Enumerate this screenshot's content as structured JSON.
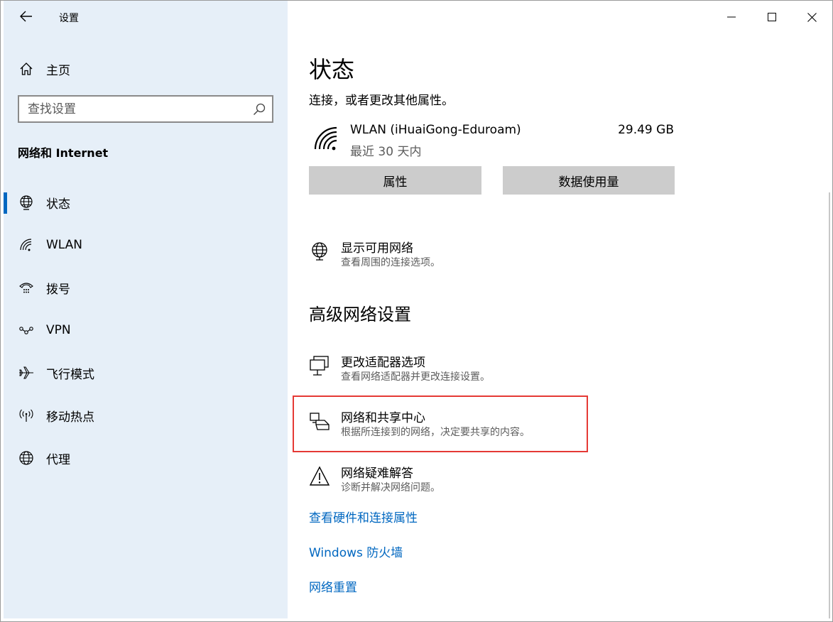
{
  "window": {
    "title": "设置"
  },
  "sidebar": {
    "home_label": "主页",
    "search_placeholder": "查找设置",
    "section_heading": "网络和 Internet",
    "items": [
      {
        "label": "状态",
        "icon": "globe-status-icon",
        "active": true
      },
      {
        "label": "WLAN",
        "icon": "wifi-icon"
      },
      {
        "label": "拨号",
        "icon": "dialup-icon"
      },
      {
        "label": "VPN",
        "icon": "vpn-icon"
      },
      {
        "label": "飞行模式",
        "icon": "airplane-icon"
      },
      {
        "label": "移动热点",
        "icon": "hotspot-icon"
      },
      {
        "label": "代理",
        "icon": "globe-icon"
      }
    ]
  },
  "main": {
    "title": "状态",
    "subtitle": "连接，或者更改其他属性。",
    "connection": {
      "name": "WLAN (iHuaiGong-Eduroam)",
      "period": "最近 30 天内",
      "usage": "29.49 GB"
    },
    "buttons": {
      "properties": "属性",
      "data_usage": "数据使用量"
    },
    "show_networks": {
      "title": "显示可用网络",
      "desc": "查看周围的连接选项。"
    },
    "advanced_heading": "高级网络设置",
    "advanced": [
      {
        "title": "更改适配器选项",
        "desc": "查看网络适配器并更改连接设置。"
      },
      {
        "title": "网络和共享中心",
        "desc": "根据所连接到的网络，决定要共享的内容。"
      },
      {
        "title": "网络疑难解答",
        "desc": "诊断并解决网络问题。"
      }
    ],
    "links": [
      "查看硬件和连接属性",
      "Windows 防火墙",
      "网络重置"
    ]
  },
  "colors": {
    "accent": "#0067c0",
    "sidebar_bg": "#e6eff8",
    "highlight": "#e53935"
  }
}
